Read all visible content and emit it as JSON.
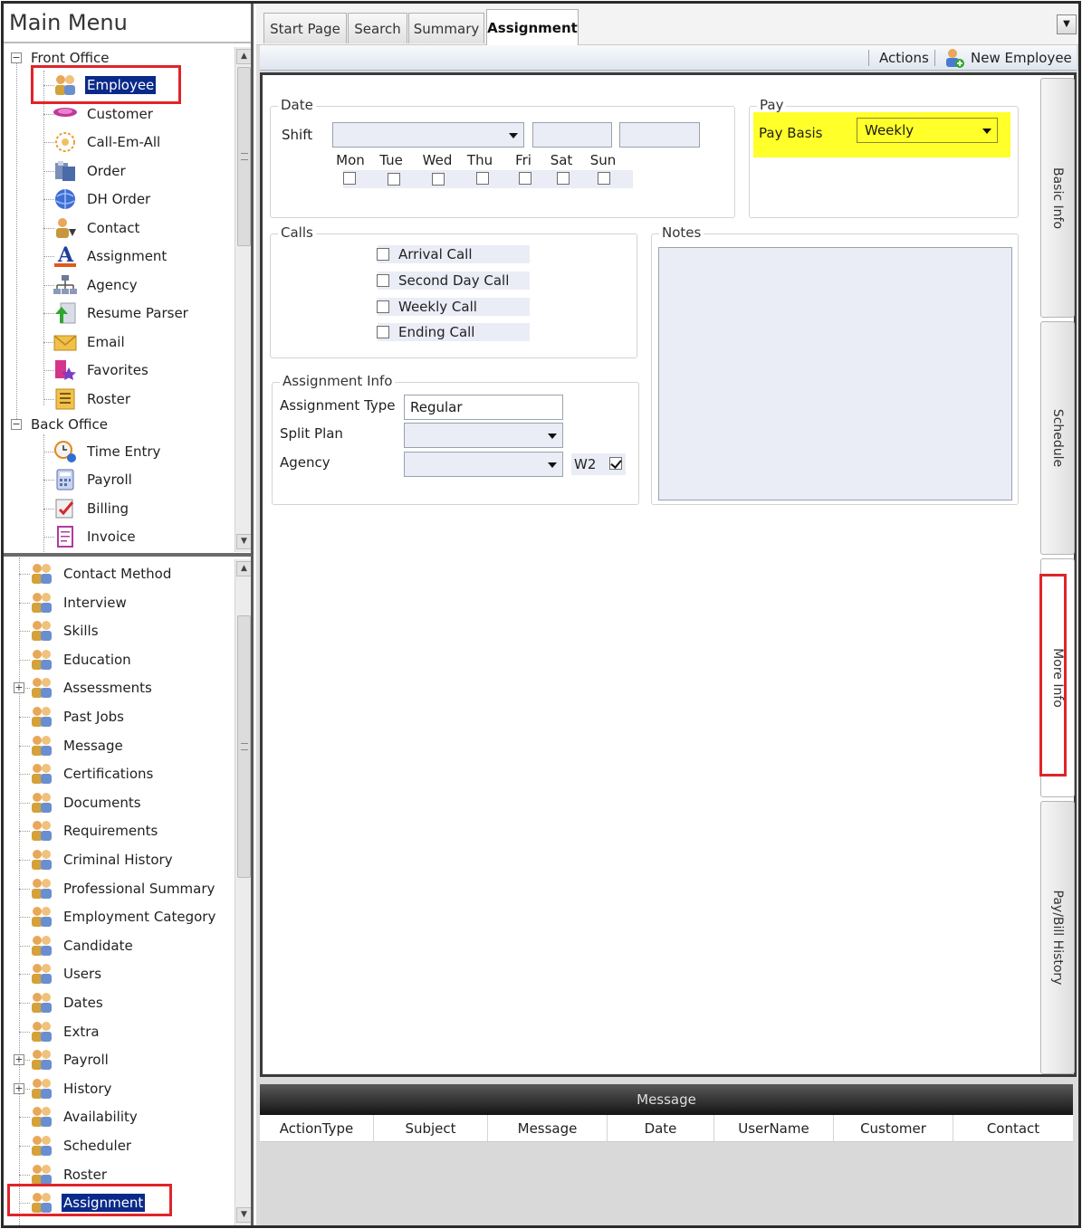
{
  "main_menu": {
    "title": "Main Menu"
  },
  "front_office": {
    "label": "Front Office",
    "items": [
      {
        "label": "Employee",
        "icon": "people-icon",
        "selected": true
      },
      {
        "label": "Customer",
        "icon": "customer-icon"
      },
      {
        "label": "Call-Em-All",
        "icon": "phone-ring-icon"
      },
      {
        "label": "Order",
        "icon": "order-icon"
      },
      {
        "label": "DH Order",
        "icon": "globe-icon"
      },
      {
        "label": "Contact",
        "icon": "contact-icon"
      },
      {
        "label": "Assignment",
        "icon": "letter-a-icon"
      },
      {
        "label": "Agency",
        "icon": "org-chart-icon"
      },
      {
        "label": "Resume Parser",
        "icon": "upload-arrow-icon"
      },
      {
        "label": "Email",
        "icon": "envelope-icon"
      },
      {
        "label": "Favorites",
        "icon": "favorites-icon"
      },
      {
        "label": "Roster",
        "icon": "roster-icon"
      }
    ]
  },
  "back_office": {
    "label": "Back Office",
    "items": [
      {
        "label": "Time Entry",
        "icon": "clock-icon"
      },
      {
        "label": "Payroll",
        "icon": "calculator-icon"
      },
      {
        "label": "Billing",
        "icon": "billing-icon"
      },
      {
        "label": "Invoice",
        "icon": "invoice-icon"
      }
    ]
  },
  "employee_sections": [
    {
      "label": "Contact Method",
      "expandable": false
    },
    {
      "label": "Interview",
      "expandable": false
    },
    {
      "label": "Skills",
      "expandable": false
    },
    {
      "label": "Education",
      "expandable": false
    },
    {
      "label": "Assessments",
      "expandable": true
    },
    {
      "label": "Past Jobs",
      "expandable": false
    },
    {
      "label": "Message",
      "expandable": false
    },
    {
      "label": "Certifications",
      "expandable": false
    },
    {
      "label": "Documents",
      "expandable": false
    },
    {
      "label": "Requirements",
      "expandable": false
    },
    {
      "label": "Criminal History",
      "expandable": false
    },
    {
      "label": "Professional Summary",
      "expandable": false
    },
    {
      "label": "Employment Category",
      "expandable": false
    },
    {
      "label": "Candidate",
      "expandable": false
    },
    {
      "label": "Users",
      "expandable": false
    },
    {
      "label": "Dates",
      "expandable": false
    },
    {
      "label": "Extra",
      "expandable": false
    },
    {
      "label": "Payroll",
      "expandable": true
    },
    {
      "label": "History",
      "expandable": true
    },
    {
      "label": "Availability",
      "expandable": false
    },
    {
      "label": "Scheduler",
      "expandable": false
    },
    {
      "label": "Roster",
      "expandable": false
    },
    {
      "label": "Assignment",
      "expandable": false,
      "selected": true
    }
  ],
  "tabs": [
    {
      "label": "Start Page"
    },
    {
      "label": "Search"
    },
    {
      "label": "Summary"
    },
    {
      "label": "Assignment",
      "active": true
    }
  ],
  "toolbar": {
    "actions_label": "Actions",
    "new_employee_label": "New Employee"
  },
  "date_group": {
    "title": "Date",
    "shift_label": "Shift",
    "shift_value": "",
    "days": [
      {
        "label": "Mon",
        "checked": false
      },
      {
        "label": "Tue",
        "checked": false
      },
      {
        "label": "Wed",
        "checked": false
      },
      {
        "label": "Thu",
        "checked": false
      },
      {
        "label": "Fri",
        "checked": false
      },
      {
        "label": "Sat",
        "checked": false
      },
      {
        "label": "Sun",
        "checked": false
      }
    ]
  },
  "pay_group": {
    "title": "Pay",
    "pay_basis_label": "Pay Basis",
    "pay_basis_value": "Weekly"
  },
  "calls_group": {
    "title": "Calls",
    "items": [
      {
        "label": "Arrival Call",
        "checked": false
      },
      {
        "label": "Second Day Call",
        "checked": false
      },
      {
        "label": "Weekly Call",
        "checked": false
      },
      {
        "label": "Ending Call",
        "checked": false
      }
    ]
  },
  "notes_group": {
    "title": "Notes",
    "value": ""
  },
  "assignment_info": {
    "title": "Assignment Info",
    "type_label": "Assignment Type",
    "type_value": "Regular",
    "split_plan_label": "Split Plan",
    "split_plan_value": "",
    "agency_label": "Agency",
    "agency_value": "",
    "w2_label": "W2",
    "w2_checked": true
  },
  "side_tabs": [
    {
      "label": "Basic Info"
    },
    {
      "label": "Schedule"
    },
    {
      "label": "More Info",
      "active": true
    },
    {
      "label": "Pay/Bill History"
    }
  ],
  "message_panel": {
    "title": "Message",
    "columns": [
      "ActionType",
      "Subject",
      "Message",
      "Date",
      "UserName",
      "Customer",
      "Contact"
    ]
  },
  "colors": {
    "selection": "#0a2a8a",
    "highlight": "#ffff2a",
    "annotation": "#e0242a",
    "field_bg": "#eaecf6"
  }
}
